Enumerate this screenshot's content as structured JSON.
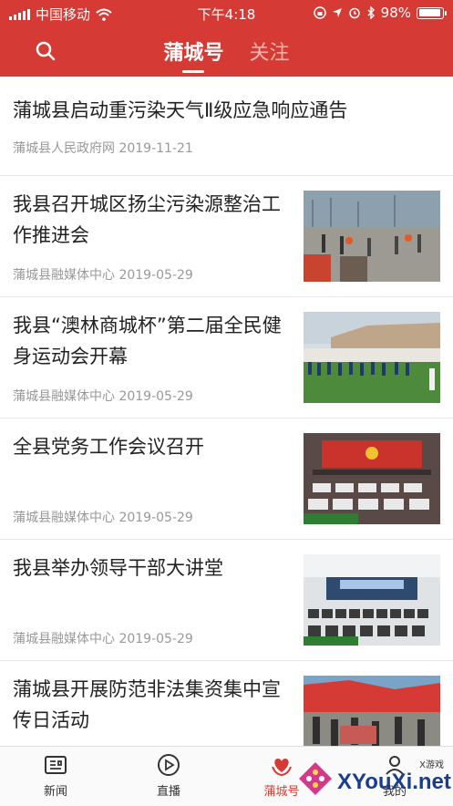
{
  "status_bar": {
    "carrier": "中国移动",
    "time": "下午4:18",
    "battery_text": "98%",
    "battery_level": 0.98
  },
  "nav": {
    "tabs": [
      {
        "label": "蒲城号",
        "active": true
      },
      {
        "label": "关注",
        "active": false
      }
    ],
    "search_icon": "search-icon",
    "accent_color": "#d63a35"
  },
  "feed": {
    "items": [
      {
        "title": "蒲城县启动重污染天气Ⅱ级应急响应通告",
        "source": "蒲城县人民政府网",
        "date": "2019-11-21"
      },
      {
        "title": "我县召开城区扬尘污染源整治工作推进会",
        "source": "蒲城县融媒体中心",
        "date": "2019-05-29"
      },
      {
        "title": "我县“澳林商城杯”第二届全民健身运动会开幕",
        "source": "蒲城县融媒体中心",
        "date": "2019-05-29"
      },
      {
        "title": "全县党务工作会议召开",
        "source": "蒲城县融媒体中心",
        "date": "2019-05-29"
      },
      {
        "title": "我县举办领导干部大讲堂",
        "source": "蒲城县融媒体中心",
        "date": "2019-05-29"
      },
      {
        "title": "蒲城县开展防范非法集资集中宣传日活动",
        "source": "",
        "date": ""
      }
    ]
  },
  "tab_bar": {
    "items": [
      {
        "label": "新闻",
        "icon": "news-icon"
      },
      {
        "label": "直播",
        "icon": "play-icon"
      },
      {
        "label": "蒲城号",
        "icon": "heart-hands-icon",
        "active": true
      },
      {
        "label": "我的",
        "icon": "profile-icon"
      }
    ]
  },
  "watermark": {
    "site": "XYouXi.net",
    "small": "X游戏"
  }
}
